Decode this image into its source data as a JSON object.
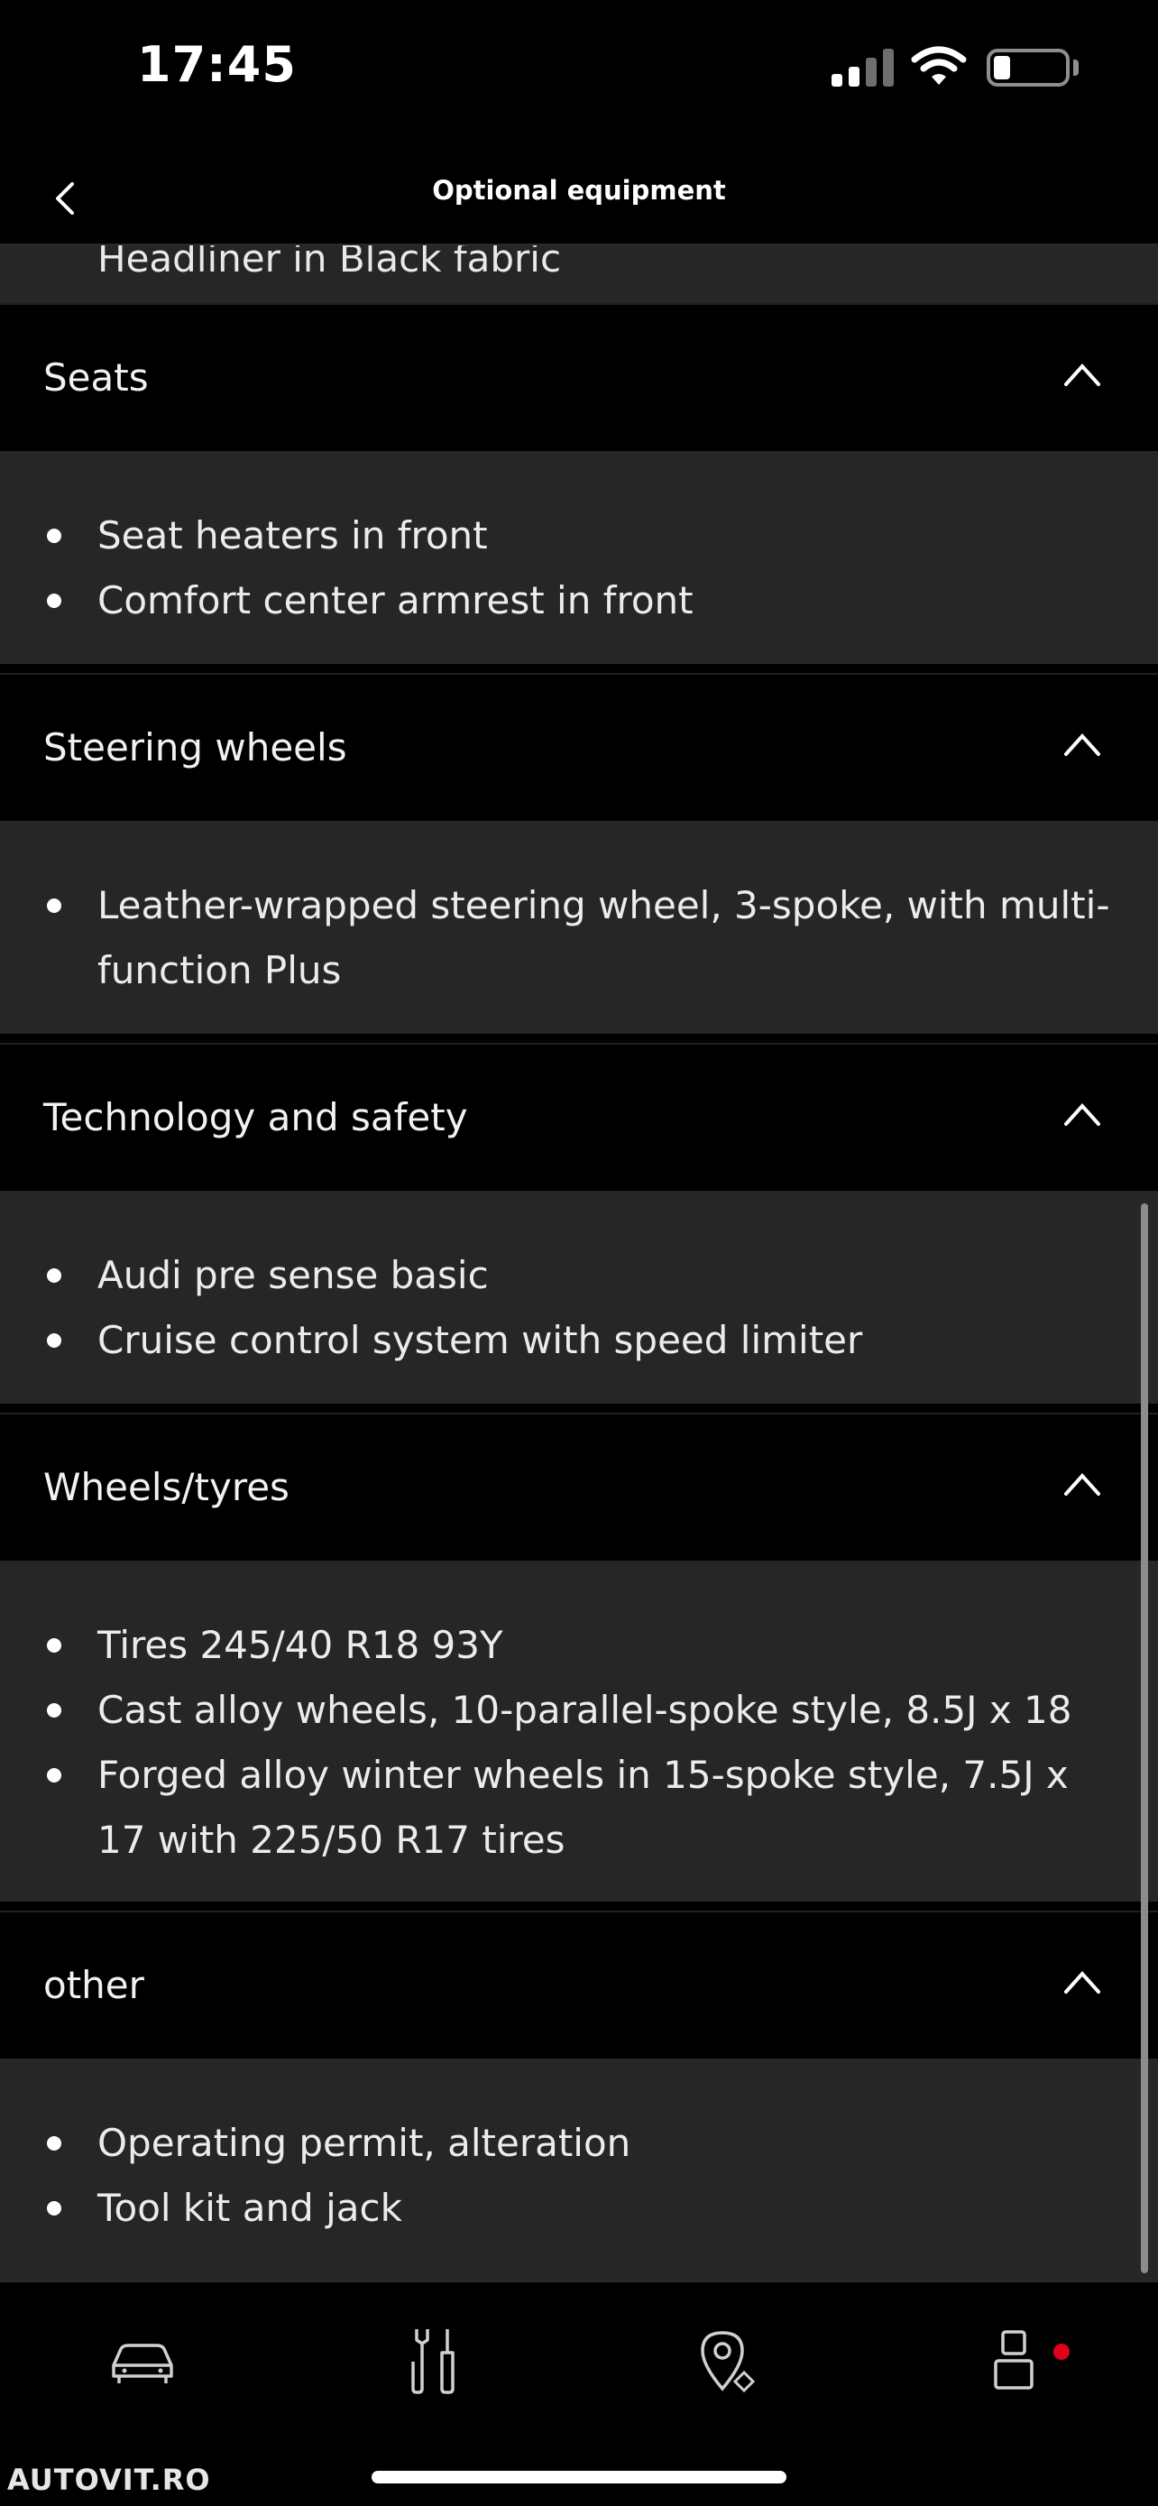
{
  "status_bar": {
    "time": "17:45"
  },
  "nav": {
    "title": "Optional equipment"
  },
  "previous_section_tail": "Headliner in Black fabric",
  "sections": [
    {
      "title": "Seats",
      "items": [
        "Seat heaters in front",
        "Comfort center armrest in front"
      ]
    },
    {
      "title": "Steering wheels",
      "items": [
        "Leather-wrapped steering wheel, 3-spoke, with multi-function Plus"
      ]
    },
    {
      "title": "Technology and safety",
      "items": [
        "Audi pre sense basic",
        "Cruise control system with speed limiter"
      ]
    },
    {
      "title": "Wheels/tyres",
      "items": [
        "Tires 245/40 R18 93Y",
        "Cast alloy wheels, 10-parallel-spoke style, 8.5J x 18",
        "Forged alloy winter wheels in 15-spoke style, 7.5J x 17 with 225/50 R17 tires"
      ]
    },
    {
      "title": "other",
      "items": [
        "Operating permit, alteration",
        "Tool kit and jack"
      ]
    }
  ],
  "tab_bar": {
    "tabs": [
      "car-icon",
      "tools-icon",
      "map-pin-icon",
      "profile-icon"
    ],
    "notification_color": "#e0001b"
  },
  "watermark": "AUTOVIT.RO"
}
